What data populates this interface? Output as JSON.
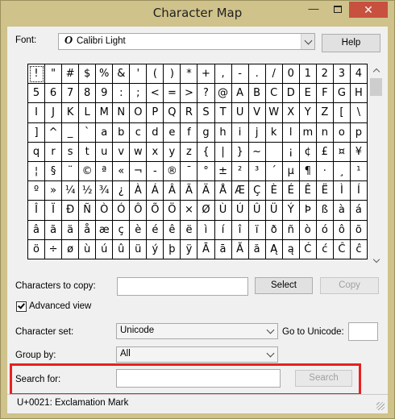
{
  "window": {
    "title": "Character Map",
    "controls": {
      "minimize": "—",
      "maximize": "",
      "close": "✕"
    }
  },
  "font": {
    "label": "Font:",
    "glyph": "O",
    "value": "Calibri Light",
    "help_button": "Help"
  },
  "grid": {
    "selected_index": 0,
    "chars": [
      "!",
      "\"",
      "#",
      "$",
      "%",
      "&",
      "'",
      "(",
      ")",
      "*",
      "+",
      ",",
      "-",
      ".",
      "/",
      "0",
      "1",
      "2",
      "3",
      "4",
      "5",
      "6",
      "7",
      "8",
      "9",
      ":",
      ";",
      "<",
      "=",
      ">",
      "?",
      "@",
      "A",
      "B",
      "C",
      "D",
      "E",
      "F",
      "G",
      "H",
      "I",
      "J",
      "K",
      "L",
      "M",
      "N",
      "O",
      "P",
      "Q",
      "R",
      "S",
      "T",
      "U",
      "V",
      "W",
      "X",
      "Y",
      "Z",
      "[",
      "\\",
      "]",
      "^",
      "_",
      "`",
      "a",
      "b",
      "c",
      "d",
      "e",
      "f",
      "g",
      "h",
      "i",
      "j",
      "k",
      "l",
      "m",
      "n",
      "o",
      "p",
      "q",
      "r",
      "s",
      "t",
      "u",
      "v",
      "w",
      "x",
      "y",
      "z",
      "{",
      "|",
      "}",
      "~",
      " ",
      "¡",
      "¢",
      "£",
      "¤",
      "¥",
      "¦",
      "§",
      "¨",
      "©",
      "ª",
      "«",
      "¬",
      "-",
      "®",
      "¯",
      "°",
      "±",
      "²",
      "³",
      "´",
      "µ",
      "¶",
      "·",
      "¸",
      "¹",
      "º",
      "»",
      "¼",
      "½",
      "¾",
      "¿",
      "À",
      "Á",
      "Â",
      "Ã",
      "Ä",
      "Å",
      "Æ",
      "Ç",
      "È",
      "É",
      "Ê",
      "Ë",
      "Ì",
      "Í",
      "Î",
      "Ï",
      "Ð",
      "Ñ",
      "Ò",
      "Ó",
      "Ô",
      "Õ",
      "Ö",
      "×",
      "Ø",
      "Ù",
      "Ú",
      "Û",
      "Ü",
      "Ý",
      "Þ",
      "ß",
      "à",
      "á",
      "â",
      "ã",
      "ä",
      "å",
      "æ",
      "ç",
      "è",
      "é",
      "ê",
      "ë",
      "ì",
      "í",
      "î",
      "ï",
      "ð",
      "ñ",
      "ò",
      "ó",
      "ô",
      "õ",
      "ö",
      "÷",
      "ø",
      "ù",
      "ú",
      "û",
      "ü",
      "ý",
      "þ",
      "ÿ",
      "Ā",
      "ā",
      "Ă",
      "ă",
      "Ą",
      "ą",
      "Ć",
      "ć",
      "Ĉ",
      "ĉ"
    ]
  },
  "copy": {
    "label": "Characters to copy:",
    "value": "",
    "select_button": "Select",
    "copy_button": "Copy"
  },
  "advanced_view": {
    "label": "Advanced view",
    "checked": true
  },
  "character_set": {
    "label": "Character set:",
    "value": "Unicode",
    "goto_label": "Go to Unicode:",
    "goto_value": ""
  },
  "group_by": {
    "label": "Group by:",
    "value": "All"
  },
  "search": {
    "label": "Search for:",
    "value": "",
    "button": "Search"
  },
  "status": {
    "text": "U+0021: Exclamation Mark"
  },
  "colors": {
    "highlight": "#e8201f",
    "close_button": "#c7503f",
    "title_bar": "#cfc28a"
  }
}
